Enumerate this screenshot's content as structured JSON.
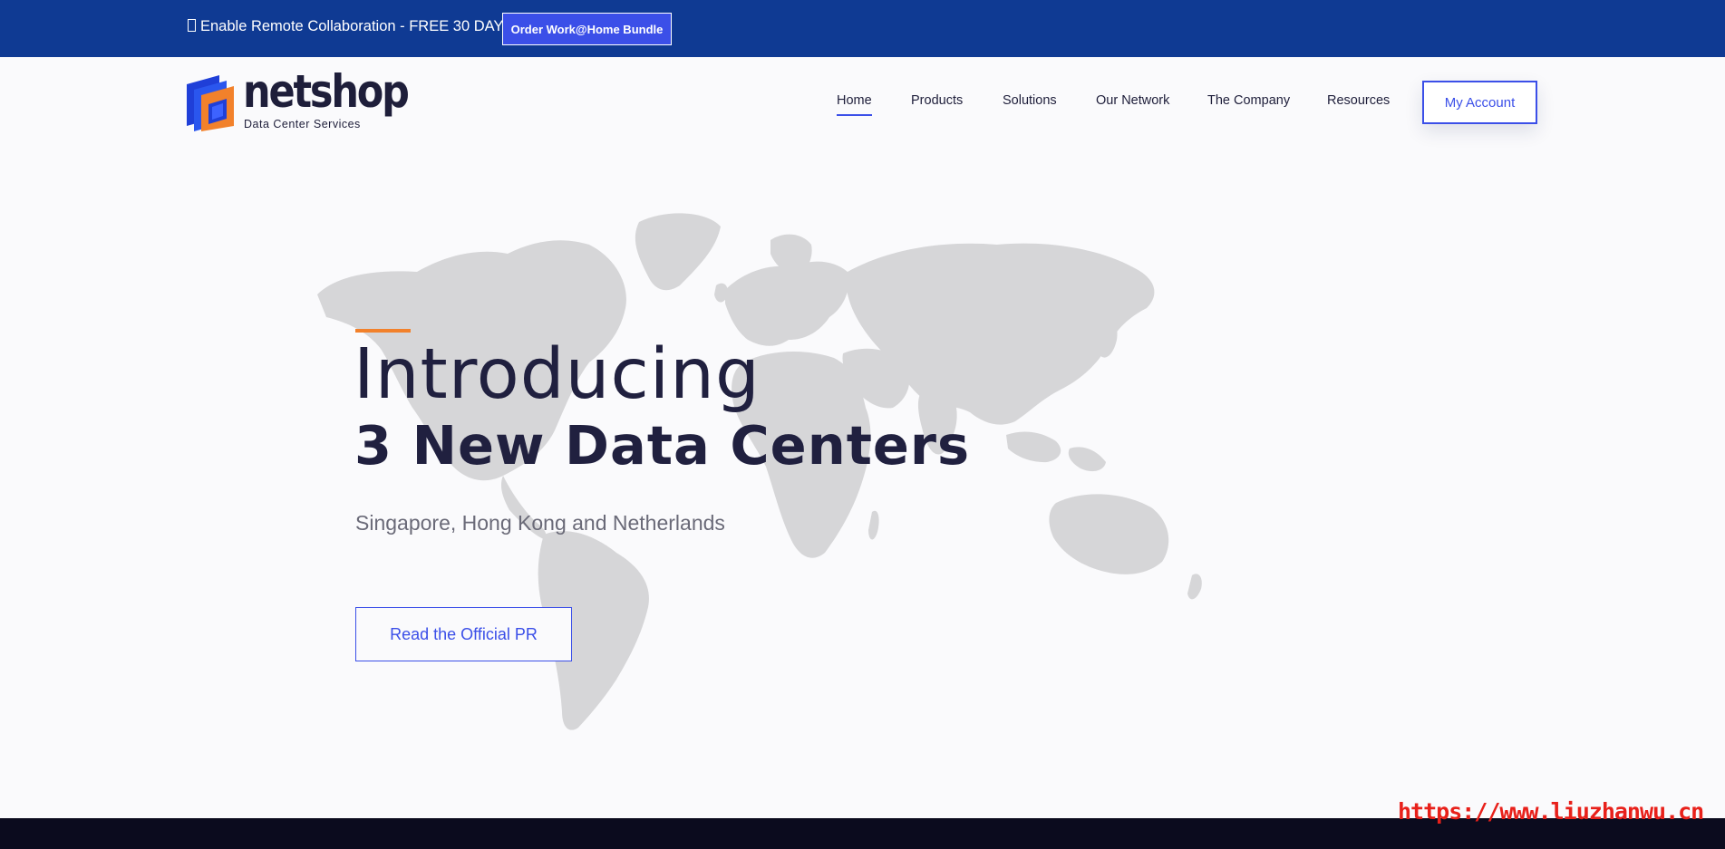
{
  "promo": {
    "text": "Enable Remote Collaboration - FREE 30 DAYS",
    "button_label": "Order Work@Home Bundle"
  },
  "brand": {
    "name": "netshop",
    "tagline": "Data Center Services",
    "colors": {
      "primary": "#0f3a93",
      "accent": "#3b4fe8",
      "orange": "#f2812b",
      "dark": "#20203f"
    }
  },
  "nav": {
    "items": [
      {
        "label": "Home",
        "active": true
      },
      {
        "label": "Products"
      },
      {
        "label": "Solutions"
      },
      {
        "label": "Our Network"
      },
      {
        "label": "The Company"
      },
      {
        "label": "Resources"
      }
    ],
    "account_label": "My Account"
  },
  "hero": {
    "title": "Introducing",
    "subtitle": "3 New Data Centers",
    "lead": "Singapore, Hong Kong and Netherlands",
    "button_label": "Read the Official PR",
    "background_icon": "world-map-icon"
  },
  "watermark": "https://www.liuzhanwu.cn"
}
